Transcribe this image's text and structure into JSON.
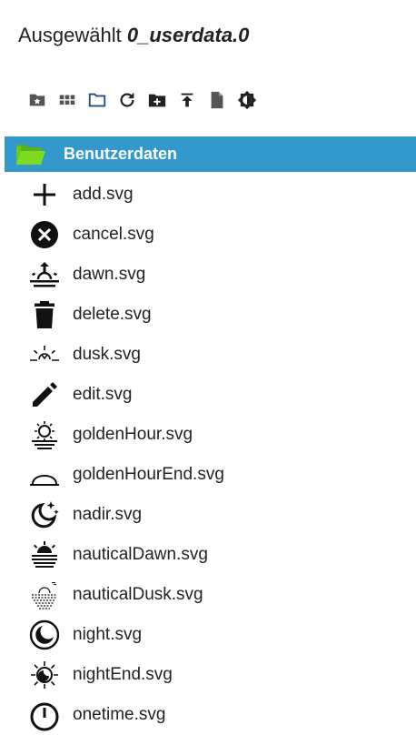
{
  "header": {
    "prefix": "Ausgewählt",
    "selected": "0_userdata.0"
  },
  "toolbar": {
    "buttons": [
      {
        "icon": "folder-star-icon"
      },
      {
        "icon": "grid-view-icon"
      },
      {
        "icon": "folder-outline-icon"
      },
      {
        "icon": "refresh-icon"
      },
      {
        "icon": "add-folder-icon"
      },
      {
        "icon": "upload-icon"
      },
      {
        "icon": "file-icon"
      },
      {
        "icon": "brightness-icon"
      }
    ]
  },
  "folder": {
    "label": "Benutzerdaten",
    "color": "#3399cc",
    "icon_color": "#7ddc1f"
  },
  "files": [
    {
      "name": "add.svg",
      "icon": "plus-icon"
    },
    {
      "name": "cancel.svg",
      "icon": "cancel-circle-icon"
    },
    {
      "name": "dawn.svg",
      "icon": "sunrise-icon"
    },
    {
      "name": "delete.svg",
      "icon": "trash-icon"
    },
    {
      "name": "dusk.svg",
      "icon": "sunset-icon"
    },
    {
      "name": "edit.svg",
      "icon": "pencil-icon"
    },
    {
      "name": "goldenHour.svg",
      "icon": "sun-horizon-icon"
    },
    {
      "name": "goldenHourEnd.svg",
      "icon": "sun-half-icon"
    },
    {
      "name": "nadir.svg",
      "icon": "moon-stars-icon"
    },
    {
      "name": "nauticalDawn.svg",
      "icon": "nautical-dawn-icon"
    },
    {
      "name": "nauticalDusk.svg",
      "icon": "nautical-dusk-icon"
    },
    {
      "name": "night.svg",
      "icon": "moon-circle-icon"
    },
    {
      "name": "nightEnd.svg",
      "icon": "sun-moon-icon"
    },
    {
      "name": "onetime.svg",
      "icon": "timer-icon"
    }
  ]
}
